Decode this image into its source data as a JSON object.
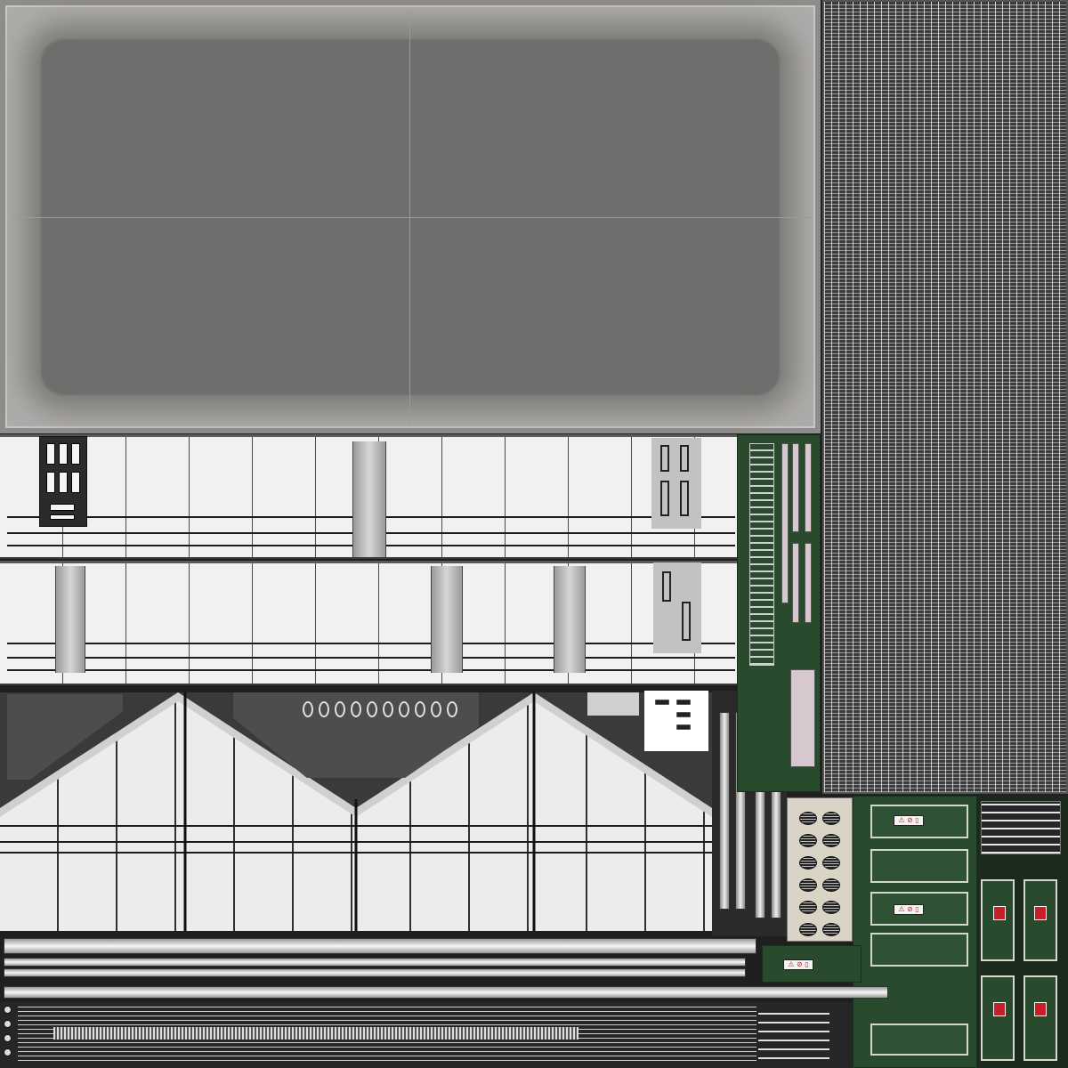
{
  "texture": {
    "description_colors": {
      "concrete": "#aeacaa",
      "grating": "#3a3a3a",
      "glass": "#f1f1f1",
      "panel": "#2b2b2b",
      "green_area": "#294a2d",
      "warning_red": "#c8202a"
    },
    "icons": [
      "warning-sign-icon",
      "vent-grille-icon",
      "switch-panel-icon"
    ],
    "warning_label_glyph": "⚠ ⊘ ▯"
  }
}
